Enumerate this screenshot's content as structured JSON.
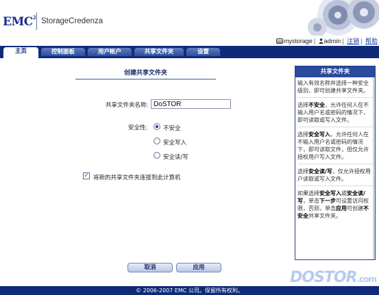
{
  "header": {
    "logo_text": "EMC",
    "logo_sup": "2",
    "brand_name": "StorageCredenza",
    "server_name": "mystorage",
    "user_name": "admin",
    "logout_link": "注销",
    "help_link": "帮助"
  },
  "nav": {
    "tabs": [
      {
        "label": "主页",
        "active": true
      },
      {
        "label": "控制面板",
        "active": false
      },
      {
        "label": "用户帐户",
        "active": false
      },
      {
        "label": "共享文件夹",
        "active": false
      },
      {
        "label": "设置",
        "active": false
      }
    ]
  },
  "main": {
    "title": "创建共享文件夹",
    "share_name_label": "共享文件夹名称:",
    "share_name_value": "DoSTOR",
    "security_label": "安全性:",
    "security_options": [
      {
        "label": "不安全",
        "checked": true
      },
      {
        "label": "安全写入",
        "checked": false
      },
      {
        "label": "安全读/写",
        "checked": false
      }
    ],
    "map_drive_label": "将新的共享文件夹连接到此计算机",
    "map_drive_checked": true,
    "cancel_button": "取消",
    "apply_button": "应用"
  },
  "help": {
    "title": "共享文件夹",
    "p1": "输入有效名称并选择一种安全级别，即可创建共享文件夹。",
    "p2_pre": "选择",
    "p2_bold": "不安全",
    "p2_post": "，允许任何人在不输入用户名或密码的情况下，即可读取或写入文件。",
    "p3_pre": "选择",
    "p3_bold": "安全写入",
    "p3_post": "，允许任何人在不输入用户名或密码的情况下，即可读取文件，但仅允许授权用户写入文件。",
    "p4_pre": "选择",
    "p4_bold": "安全读/写",
    "p4_post": "，仅允许授权用户读取或写入文件。",
    "p5_pre": "如果选择",
    "p5_bold1": "安全写入",
    "p5_mid1": "或",
    "p5_bold2": "安全读/写",
    "p5_mid2": "，单击",
    "p5_bold3": "下一步",
    "p5_mid3": "可设置访问权限，否则，单击",
    "p5_bold4": "应用",
    "p5_mid4": "可创建",
    "p5_bold5": "不安全",
    "p5_post": "共享文件夹。"
  },
  "footer": {
    "copyright": "© 2006-2007 EMC 公司。保留所有权利。"
  },
  "watermark": {
    "main": "DOSTOR",
    "suffix": ".com"
  },
  "colors": {
    "nav_bg": "#0e2a78",
    "accent": "#2a4a9c",
    "title_text": "#1d2a6a"
  }
}
